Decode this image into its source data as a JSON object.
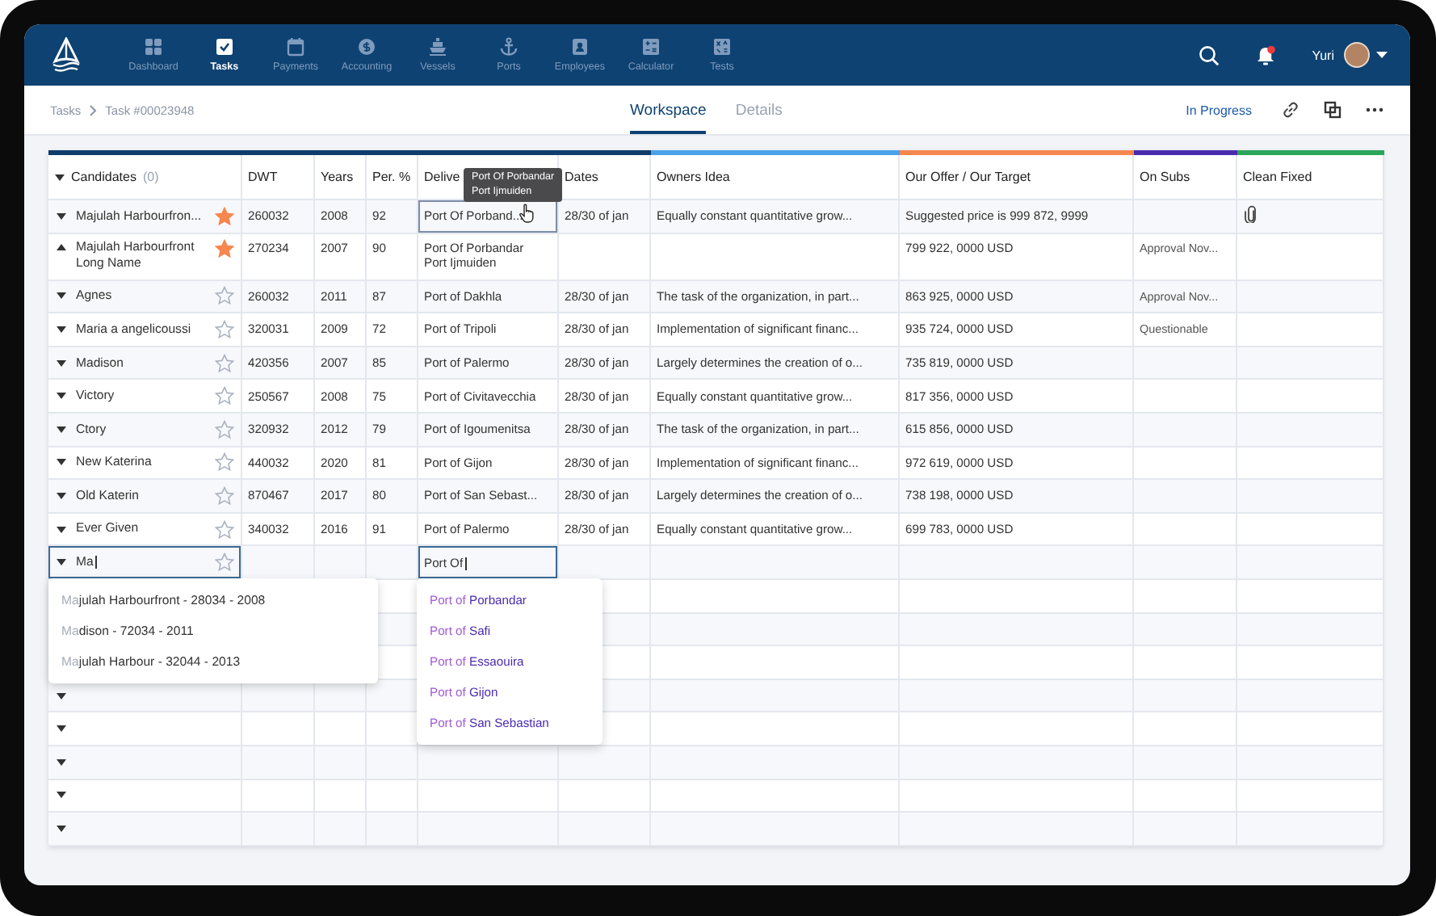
{
  "nav": {
    "items": [
      {
        "label": "Dashboard",
        "kind": "grid",
        "selected": false
      },
      {
        "label": "Tasks",
        "kind": "check",
        "selected": true
      },
      {
        "label": "Payments",
        "kind": "calendar",
        "selected": false
      },
      {
        "label": "Accounting",
        "kind": "coin",
        "selected": false
      },
      {
        "label": "Vessels",
        "kind": "ship",
        "selected": false
      },
      {
        "label": "Ports",
        "kind": "anchor",
        "selected": false
      },
      {
        "label": "Employees",
        "kind": "badge",
        "selected": false
      },
      {
        "label": "Calculator",
        "kind": "calc",
        "selected": false
      },
      {
        "label": "Tests",
        "kind": "tests",
        "selected": false
      }
    ],
    "user": "Yuri",
    "unread": true
  },
  "breadcrumb": [
    "Tasks",
    "Task #00023948"
  ],
  "tabs": [
    {
      "label": "Workspace",
      "selected": true
    },
    {
      "label": "Details",
      "selected": false
    }
  ],
  "status": "In Progress",
  "table": {
    "columns": [
      {
        "label": "Candidates",
        "count": "(0)",
        "color": "#0f3d6b"
      },
      {
        "label": "DWT",
        "color": "#0f3d6b"
      },
      {
        "label": "Years",
        "color": "#0f3d6b"
      },
      {
        "label": "Per. %",
        "color": "#0f3d6b"
      },
      {
        "label": "Delive",
        "color": "#0f3d6b"
      },
      {
        "label": "Dates",
        "color": "#0f3d6b"
      },
      {
        "label": "Owners Idea",
        "color": "#4aa3ea"
      },
      {
        "label": "Our Offer / Our Target",
        "color": "#f5874f"
      },
      {
        "label": "On Subs",
        "color": "#4a2bb0"
      },
      {
        "label": "Clean Fixed",
        "color": "#2aa55a"
      }
    ],
    "tooltip": [
      "Port Of Porbandar",
      "Port Ijmuiden"
    ],
    "rows": [
      {
        "name": "Majulah Harbourfron...",
        "starred": true,
        "expanded": false,
        "dwt": "260032",
        "years": "2008",
        "per": "92",
        "delivery": [
          "Port Of Porband..."
        ],
        "focused": true,
        "dates": "28/30 of jan",
        "owners_idea": "Equally constant quantitative grow...",
        "offer": "Suggested price is 999 872, 9999",
        "attachment": true
      },
      {
        "name": "Majulah Harbourfront Long Name",
        "starred": true,
        "expanded": true,
        "dwt": "270234",
        "years": "2007",
        "per": "90",
        "delivery": [
          "Port Of Porbandar",
          "Port Ijmuiden"
        ],
        "focused": false,
        "offer": "799 922, 0000 USD",
        "on_subs": "Approval Nov...",
        "attachment": false
      },
      {
        "name": "Agnes",
        "starred": false,
        "expanded": false,
        "dwt": "260032",
        "years": "2011",
        "per": "87",
        "delivery": [
          "Port of Dakhla"
        ],
        "focused": false,
        "dates": "28/30 of jan",
        "owners_idea": "The task of the organization, in part...",
        "offer": "863 925, 0000 USD",
        "on_subs": "Approval Nov...",
        "attachment": false
      },
      {
        "name": "Maria a angelicoussi",
        "starred": false,
        "expanded": false,
        "dwt": "320031",
        "years": "2009",
        "per": "72",
        "delivery": [
          "Port of Tripoli"
        ],
        "focused": false,
        "dates": "28/30 of jan",
        "owners_idea": "Implementation of significant financ...",
        "offer": "935 724, 0000 USD",
        "on_subs": "Questionable",
        "attachment": false
      },
      {
        "name": "Madison",
        "starred": false,
        "expanded": false,
        "dwt": "420356",
        "years": "2007",
        "per": "85",
        "delivery": [
          "Port of Palermo"
        ],
        "focused": false,
        "dates": "28/30 of jan",
        "owners_idea": "Largely determines the creation of o...",
        "offer": "735 819, 0000 USD",
        "attachment": false
      },
      {
        "name": "Victory",
        "starred": false,
        "expanded": false,
        "dwt": "250567",
        "years": "2008",
        "per": "75",
        "delivery": [
          "Port of Civitavecchia"
        ],
        "focused": false,
        "dates": "28/30 of jan",
        "owners_idea": "Equally constant quantitative grow...",
        "offer": "817 356, 0000 USD",
        "attachment": false
      },
      {
        "name": "Ctory",
        "starred": false,
        "expanded": false,
        "dwt": "320932",
        "years": "2012",
        "per": "79",
        "delivery": [
          "Port of Igoumenitsa"
        ],
        "focused": false,
        "dates": "28/30 of jan",
        "owners_idea": "The task of the organization, in part...",
        "offer": "615 856, 0000 USD",
        "attachment": false
      },
      {
        "name": "New Katerina",
        "starred": false,
        "expanded": false,
        "dwt": "440032",
        "years": "2020",
        "per": "81",
        "delivery": [
          "Port of Gijon"
        ],
        "focused": false,
        "dates": "28/30 of jan",
        "owners_idea": "Implementation of significant financ...",
        "offer": "972 619, 0000 USD",
        "attachment": false
      },
      {
        "name": "Old Katerin",
        "starred": false,
        "expanded": false,
        "dwt": "870467",
        "years": "2017",
        "per": "80",
        "delivery": [
          "Port of San Sebast..."
        ],
        "focused": false,
        "dates": "28/30 of jan",
        "owners_idea": "Largely determines the creation of o...",
        "offer": "738 198, 0000 USD",
        "attachment": false
      },
      {
        "name": "Ever Given",
        "starred": false,
        "expanded": false,
        "dwt": "340032",
        "years": "2016",
        "per": "91",
        "delivery": [
          "Port of Palermo"
        ],
        "focused": false,
        "dates": "28/30 of jan",
        "owners_idea": "Equally constant quantitative grow...",
        "offer": "699 783, 0000 USD",
        "attachment": false
      }
    ],
    "new_row": {
      "name": "Ma",
      "starred": false,
      "delivery": "Port Of"
    },
    "candidate_suggestions": [
      {
        "match": "Ma",
        "rest": "julah Harbourfront - 28034 - 2008"
      },
      {
        "match": "Ma",
        "rest": "dison - 72034 - 2011"
      },
      {
        "match": "Ma",
        "rest": "julah Harbour - 32044 - 2013"
      }
    ],
    "port_suggestions": [
      {
        "match": "Port of",
        "rest": "Porbandar"
      },
      {
        "match": "Port of",
        "rest": "Safi"
      },
      {
        "match": "Port of",
        "rest": "Essaouira"
      },
      {
        "match": "Port of",
        "rest": "Gijon"
      },
      {
        "match": "Port of",
        "rest": "San Sebastian"
      }
    ]
  }
}
